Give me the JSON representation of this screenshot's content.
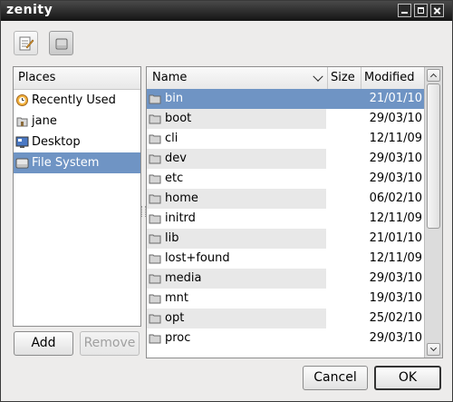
{
  "window": {
    "title": "zenity"
  },
  "toolbar": {
    "edit_icon": "text-editor-icon",
    "disk_icon": "drive-icon"
  },
  "places": {
    "header": "Places",
    "items": [
      {
        "label": "Recently Used",
        "icon": "recent-icon"
      },
      {
        "label": "jane",
        "icon": "home-folder-icon"
      },
      {
        "label": "Desktop",
        "icon": "desktop-icon"
      },
      {
        "label": "File System",
        "icon": "drive-icon",
        "selected": true
      }
    ],
    "add_label": "Add",
    "remove_label": "Remove"
  },
  "files": {
    "columns": {
      "name": "Name",
      "size": "Size",
      "modified": "Modified"
    },
    "rows": [
      {
        "name": "bin",
        "modified": "21/01/10",
        "selected": true
      },
      {
        "name": "boot",
        "modified": "29/03/10"
      },
      {
        "name": "cli",
        "modified": "12/11/09"
      },
      {
        "name": "dev",
        "modified": "29/03/10"
      },
      {
        "name": "etc",
        "modified": "29/03/10"
      },
      {
        "name": "home",
        "modified": "06/02/10"
      },
      {
        "name": "initrd",
        "modified": "12/11/09"
      },
      {
        "name": "lib",
        "modified": "21/01/10"
      },
      {
        "name": "lost+found",
        "modified": "12/11/09"
      },
      {
        "name": "media",
        "modified": "29/03/10"
      },
      {
        "name": "mnt",
        "modified": "19/03/10"
      },
      {
        "name": "opt",
        "modified": "25/02/10"
      },
      {
        "name": "proc",
        "modified": "29/03/10"
      }
    ]
  },
  "dialog": {
    "cancel_label": "Cancel",
    "ok_label": "OK"
  },
  "colors": {
    "selection": "#6f94c4",
    "titlebar": "#1e1e1e"
  }
}
